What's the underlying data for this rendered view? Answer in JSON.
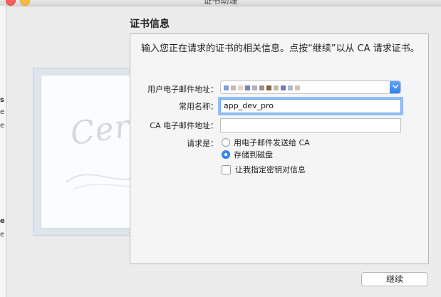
{
  "window": {
    "title": "证书助理"
  },
  "form": {
    "heading": "证书信息",
    "intro": "输入您正在请求的证书的相关信息。点按“继续”以从 CA 请求证书。",
    "email_label": "用户电子邮件地址：",
    "common_name_label": "常用名称：",
    "common_name_value": "app_dev_pro",
    "ca_email_label": "CA 电子邮件地址：",
    "ca_email_value": "",
    "request_label": "请求是：",
    "option_email_ca": "用电子邮件发送给 CA",
    "option_save_disk": "存储到磁盘",
    "option_key_pair": "让我指定密钥对信息",
    "selected_option": "存储到磁盘"
  },
  "illustration": {
    "word": "Certificate"
  },
  "email_blur_colors": [
    "#7da0d8",
    "#c8b9b2",
    "#e7d2c4",
    "#7a82b8",
    "#b8a9c6",
    "#a68d88",
    "#8d5e3e",
    "#cbb7a6",
    "#6f7db5",
    "#aeb8cf",
    "#d6c0b4"
  ],
  "left_edge_glyphs": [
    "s",
    "e",
    "e",
    "e",
    "e"
  ],
  "buttons": {
    "continue": "继续"
  }
}
